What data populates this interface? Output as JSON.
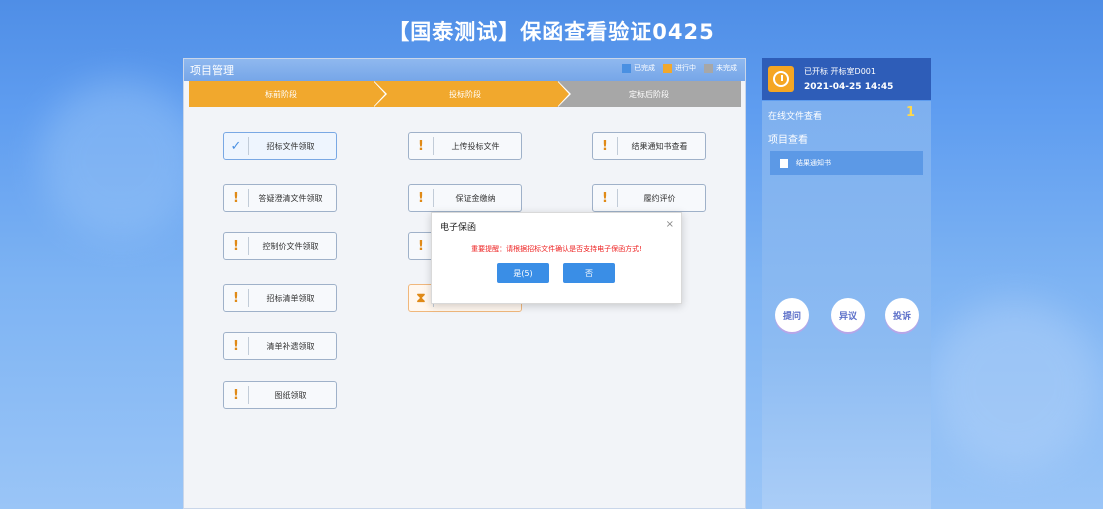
{
  "page": {
    "title": "【国泰测试】保函查看验证0425"
  },
  "main": {
    "header": "项目管理",
    "legend": [
      {
        "label": "已完成",
        "color": "#4a90e2"
      },
      {
        "label": "进行中",
        "color": "#f1a82d"
      },
      {
        "label": "未完成",
        "color": "#a7a7a7"
      }
    ],
    "steps": [
      {
        "label": "标前阶段"
      },
      {
        "label": "投标阶段"
      },
      {
        "label": "定标后阶段"
      }
    ],
    "tasks": [
      {
        "label": "招标文件领取",
        "icon": "✓"
      },
      {
        "label": "答疑澄清文件领取",
        "icon": "!"
      },
      {
        "label": "控制价文件领取",
        "icon": "!"
      },
      {
        "label": "招标清单领取",
        "icon": "!"
      },
      {
        "label": "清单补遗领取",
        "icon": "!"
      },
      {
        "label": "图纸领取",
        "icon": "!"
      },
      {
        "label": "上传投标文件",
        "icon": "!"
      },
      {
        "label": "保证金缴纳",
        "icon": "!"
      },
      {
        "label": "!",
        "icon": "!"
      },
      {
        "label": "",
        "icon": "⧗"
      },
      {
        "label": "结果通知书查看",
        "icon": "!"
      },
      {
        "label": "履约评价",
        "icon": "!"
      }
    ]
  },
  "dialog": {
    "title": "电子保函",
    "close": "×",
    "message": "重要提醒：请根据招标文件确认是否支持电子保函方式!",
    "yes": "是(5)",
    "no": "否"
  },
  "right": {
    "room": "已开标 开标室D001",
    "date": "2021-04-25 14:45",
    "online_label": "在线文件查看",
    "online_count": "1",
    "project_label": "项目查看",
    "notice": "结果通知书",
    "buttons": [
      "提问",
      "异议",
      "投诉"
    ]
  }
}
